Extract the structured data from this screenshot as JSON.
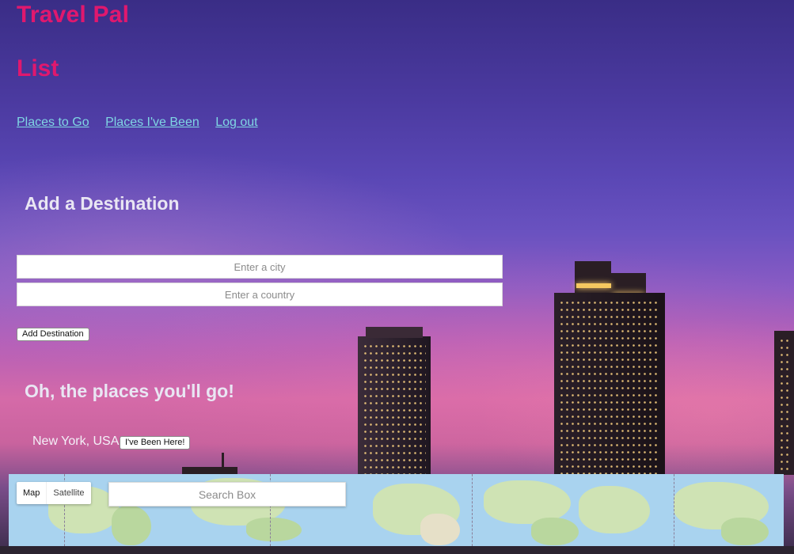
{
  "header": {
    "brand": "Travel Pal",
    "page_title": "List"
  },
  "nav": {
    "items": [
      {
        "label": "Places to Go"
      },
      {
        "label": "Places I've Been"
      },
      {
        "label": "Log out"
      }
    ]
  },
  "add_section": {
    "heading": "Add a Destination",
    "city_placeholder": "Enter a city",
    "country_placeholder": "Enter a country",
    "button_label": "Add Destination"
  },
  "places_section": {
    "heading": "Oh, the places you'll go!",
    "items": [
      {
        "place": "New York, USA",
        "button_label": "I've Been Here!"
      }
    ]
  },
  "map": {
    "map_type_options": [
      "Map",
      "Satellite"
    ],
    "selected_map_type": "Map",
    "search_placeholder": "Search Box"
  },
  "colors": {
    "brand": "#e0186e",
    "link": "#7fd6e3",
    "heading": "#e9e6f3"
  }
}
